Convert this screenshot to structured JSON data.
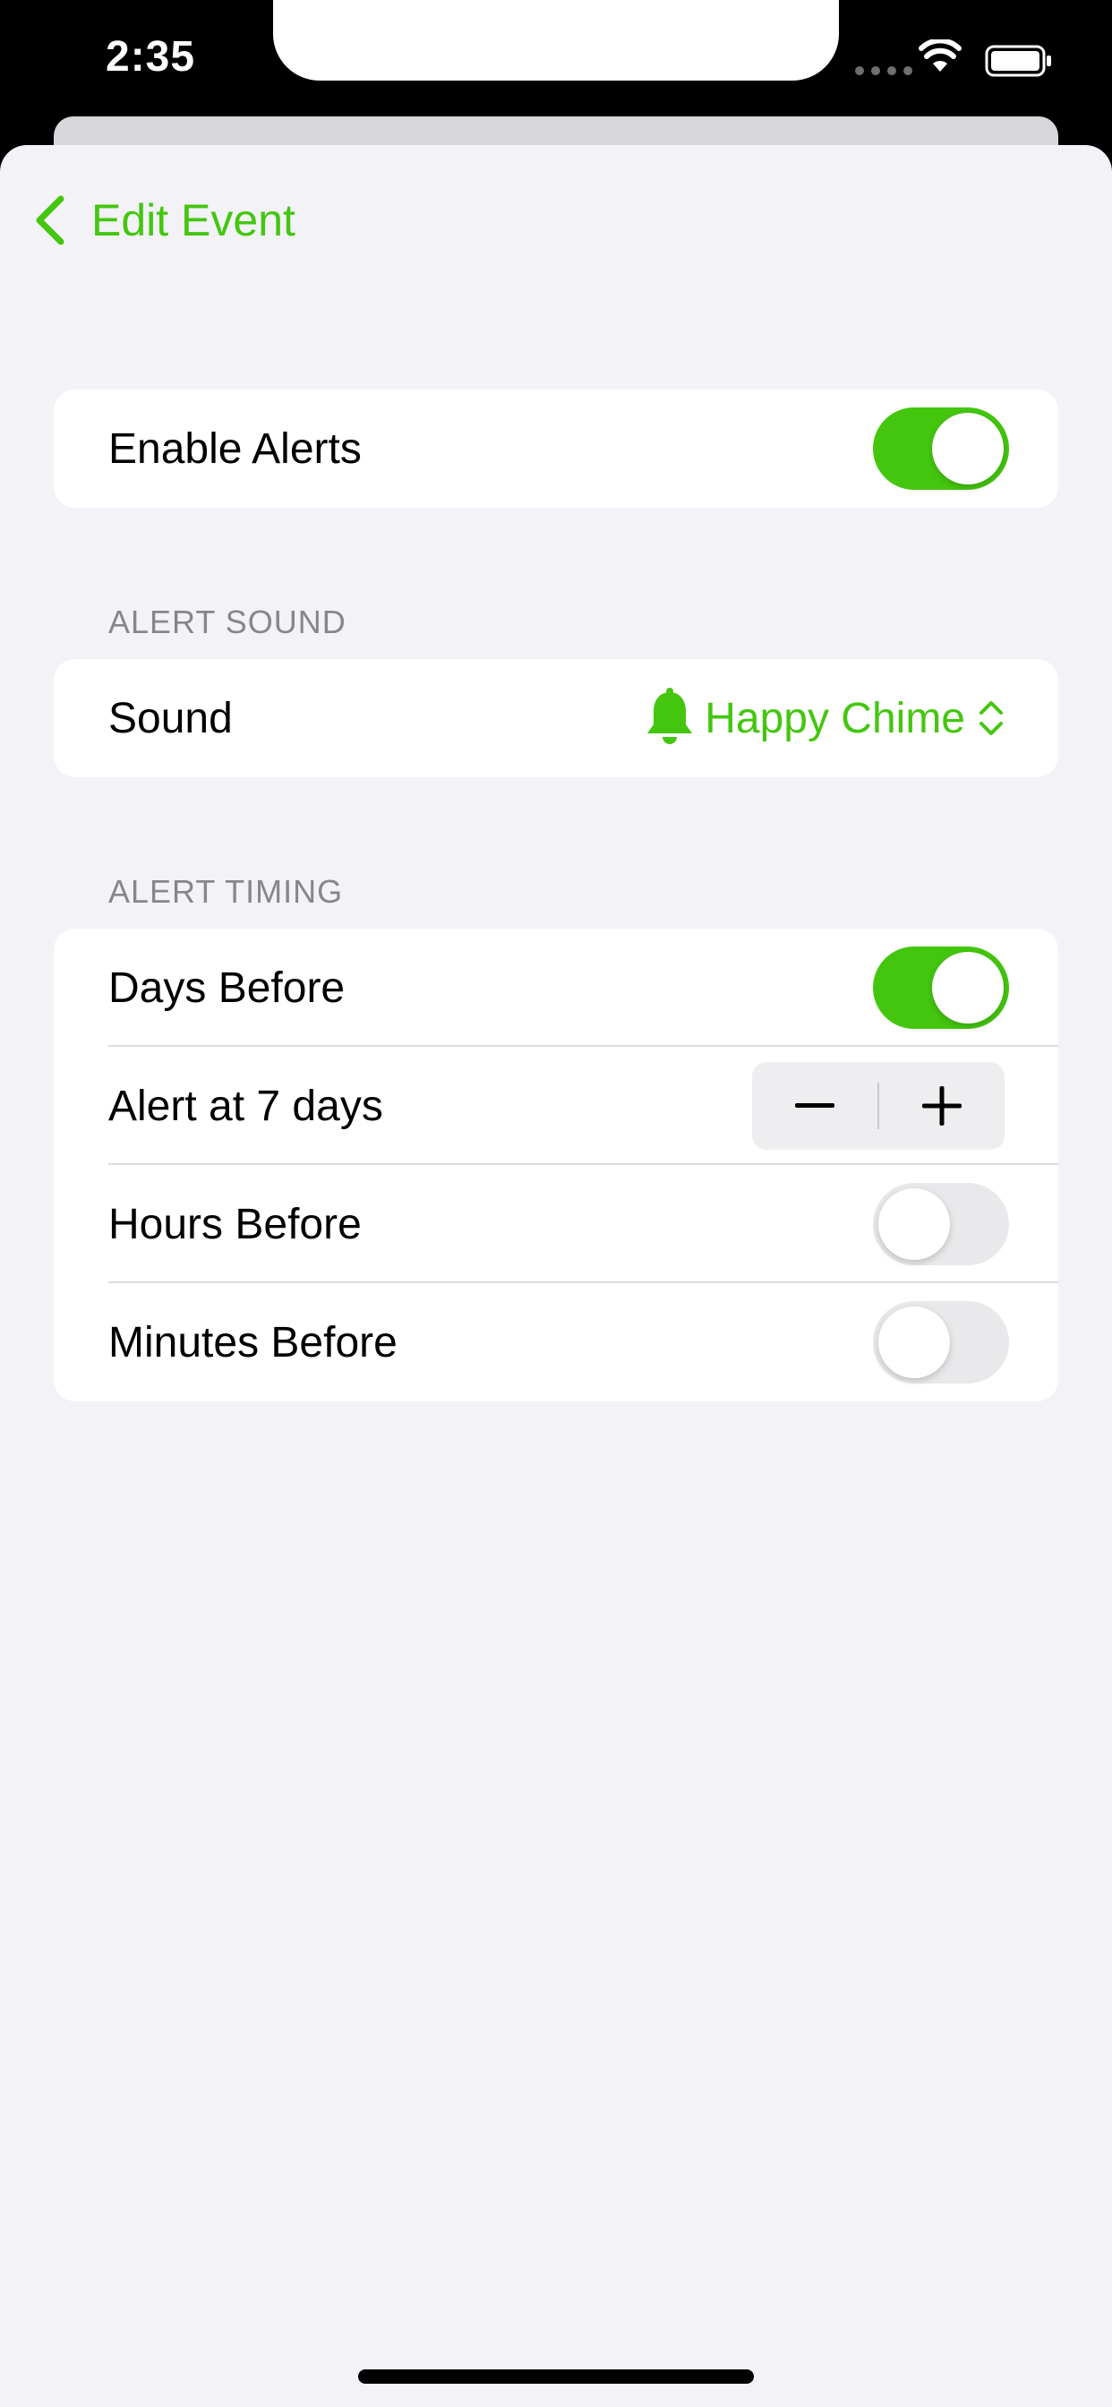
{
  "status_bar": {
    "time": "2:35"
  },
  "nav": {
    "back_label": "Edit Event"
  },
  "colors": {
    "accent": "#44c60f",
    "background": "#f2f2f7",
    "section_header": "#86868b"
  },
  "enable_alerts": {
    "label": "Enable Alerts",
    "on": true
  },
  "alert_sound": {
    "header": "ALERT SOUND",
    "label": "Sound",
    "value": "Happy Chime",
    "icon": "bell-icon"
  },
  "alert_timing": {
    "header": "ALERT TIMING",
    "rows": [
      {
        "label": "Days Before",
        "on": true
      },
      {
        "label": "Alert at 7 days"
      },
      {
        "label": "Hours Before",
        "on": false
      },
      {
        "label": "Minutes Before",
        "on": false
      }
    ]
  }
}
